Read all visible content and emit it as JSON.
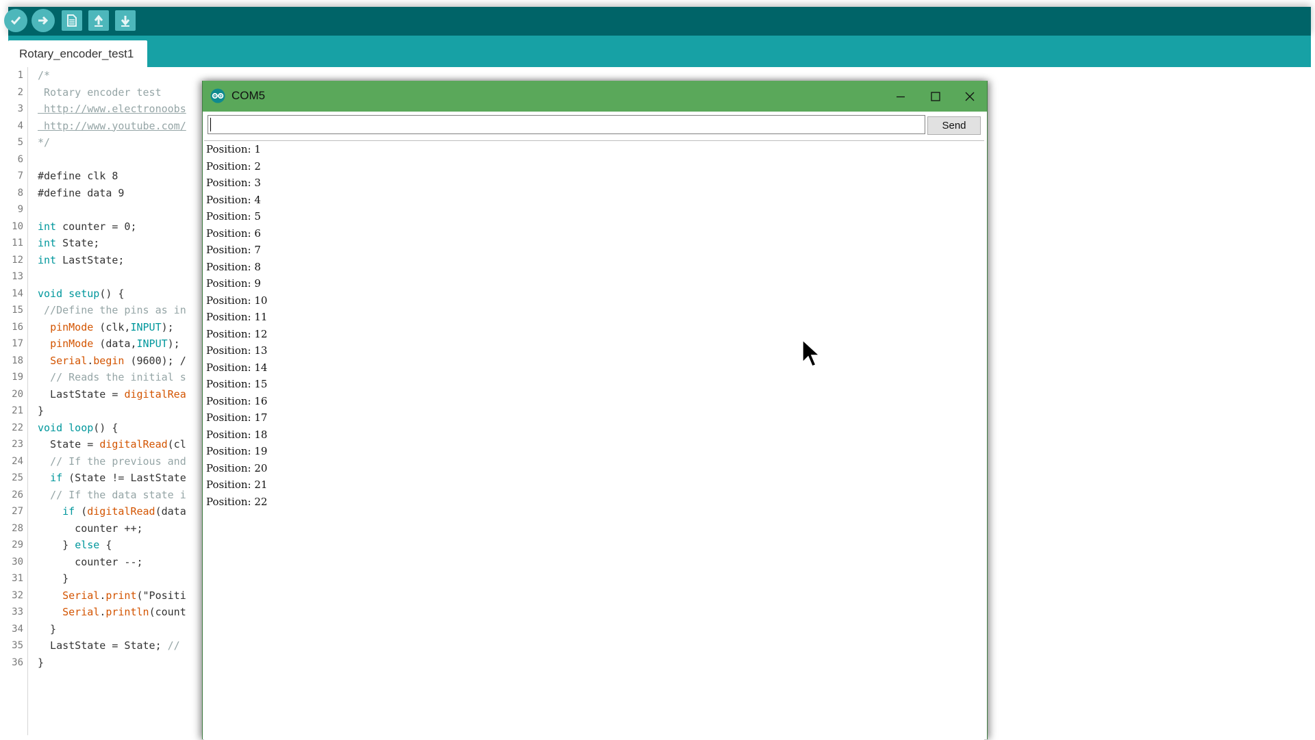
{
  "toolbar": {
    "buttons": [
      {
        "name": "verify",
        "icon": "checkmark-icon"
      },
      {
        "name": "upload",
        "icon": "arrow-right-icon"
      },
      {
        "name": "new",
        "icon": "new-file-icon"
      },
      {
        "name": "open",
        "icon": "arrow-up-icon"
      },
      {
        "name": "save",
        "icon": "arrow-down-icon"
      }
    ],
    "color": "#006468"
  },
  "tab": {
    "label": "Rotary_encoder_test1",
    "strip_color": "#17a1a5"
  },
  "editor": {
    "lines": [
      {
        "n": "1",
        "text": "/*"
      },
      {
        "n": "2",
        "text": " Rotary encoder test"
      },
      {
        "n": "3",
        "text": " http://www.electronoobs"
      },
      {
        "n": "4",
        "text": " http://www.youtube.com/"
      },
      {
        "n": "5",
        "text": "*/"
      },
      {
        "n": "6",
        "text": ""
      },
      {
        "n": "7",
        "text": "#define clk 8"
      },
      {
        "n": "8",
        "text": "#define data 9"
      },
      {
        "n": "9",
        "text": ""
      },
      {
        "n": "10",
        "text": "int counter = 0;"
      },
      {
        "n": "11",
        "text": "int State;"
      },
      {
        "n": "12",
        "text": "int LastState;"
      },
      {
        "n": "13",
        "text": ""
      },
      {
        "n": "14",
        "text": "void setup() {"
      },
      {
        "n": "15",
        "text": " //Define the pins as in"
      },
      {
        "n": "16",
        "text": "  pinMode (clk,INPUT);"
      },
      {
        "n": "17",
        "text": "  pinMode (data,INPUT);"
      },
      {
        "n": "18",
        "text": "  Serial.begin (9600); /"
      },
      {
        "n": "19",
        "text": "  // Reads the initial s"
      },
      {
        "n": "20",
        "text": "  LastState = digitalRea"
      },
      {
        "n": "21",
        "text": "}"
      },
      {
        "n": "22",
        "text": "void loop() {"
      },
      {
        "n": "23",
        "text": "  State = digitalRead(cl"
      },
      {
        "n": "24",
        "text": "  // If the previous and"
      },
      {
        "n": "25",
        "text": "  if (State != LastState"
      },
      {
        "n": "26",
        "text": "  // If the data state i"
      },
      {
        "n": "27",
        "text": "    if (digitalRead(data"
      },
      {
        "n": "28",
        "text": "      counter ++;"
      },
      {
        "n": "29",
        "text": "    } else {"
      },
      {
        "n": "30",
        "text": "      counter --;"
      },
      {
        "n": "31",
        "text": "    }"
      },
      {
        "n": "32",
        "text": "    Serial.print(\"Positi"
      },
      {
        "n": "33",
        "text": "    Serial.println(count"
      },
      {
        "n": "34",
        "text": "  }"
      },
      {
        "n": "35",
        "text": "  LastState = State; //"
      },
      {
        "n": "36",
        "text": "}"
      }
    ]
  },
  "serial_monitor": {
    "title": "COM5",
    "title_icon": "arduino-logo-icon",
    "titlebar_color": "#5aa85a",
    "controls": {
      "minimize_icon": "minimize-icon",
      "maximize_icon": "maximize-icon",
      "close_icon": "close-icon"
    },
    "input_value": "",
    "send_label": "Send",
    "output": [
      "Position: 1",
      "Position: 2",
      "Position: 3",
      "Position: 4",
      "Position: 5",
      "Position: 6",
      "Position: 7",
      "Position: 8",
      "Position: 9",
      "Position: 10",
      "Position: 11",
      "Position: 12",
      "Position: 13",
      "Position: 14",
      "Position: 15",
      "Position: 16",
      "Position: 17",
      "Position: 18",
      "Position: 19",
      "Position: 20",
      "Position: 21",
      "Position: 22"
    ]
  },
  "cursor": {
    "icon": "mouse-pointer-icon"
  }
}
